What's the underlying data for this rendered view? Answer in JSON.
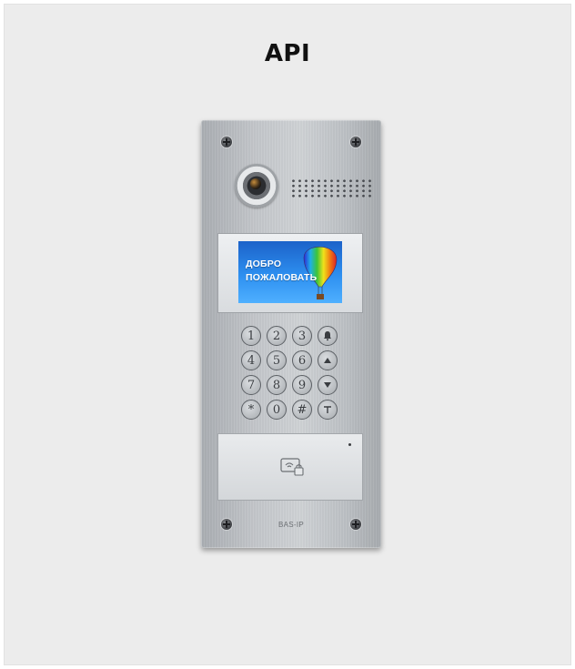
{
  "page": {
    "title": "API"
  },
  "panel": {
    "screen_text_line1": "ДОБРО",
    "screen_text_line2": "ПОЖАЛОВАТЬ",
    "keypad": [
      "1",
      "2",
      "3",
      "bell-icon",
      "4",
      "5",
      "6",
      "up-icon",
      "7",
      "8",
      "9",
      "down-icon",
      "*",
      "0",
      "#",
      "key-icon"
    ],
    "brand": "BAS-IP"
  }
}
